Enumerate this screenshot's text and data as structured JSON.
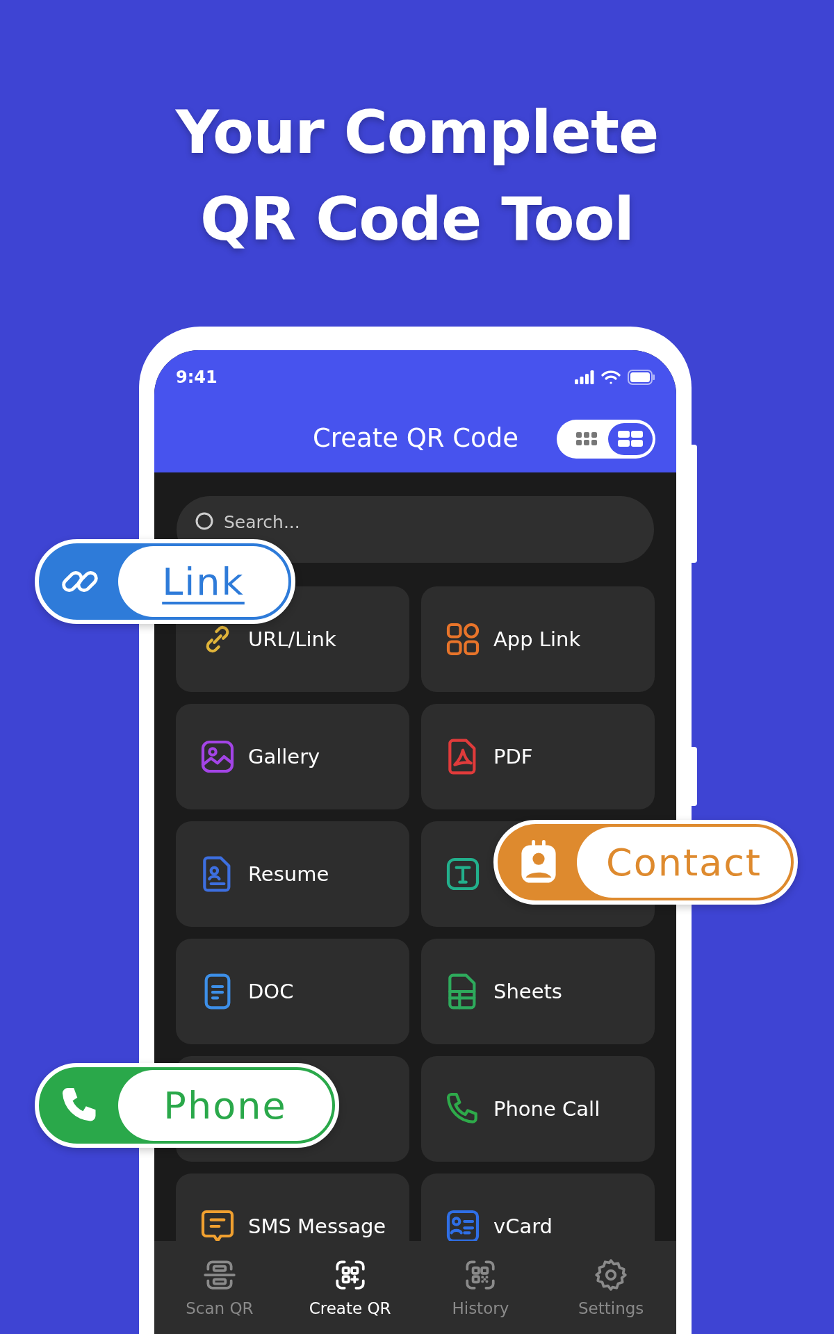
{
  "headline": [
    "Your Complete",
    "QR Code Tool"
  ],
  "status_bar": {
    "time": "9:41"
  },
  "header": {
    "title": "Create QR Code",
    "view_toggle": [
      {
        "kind": "grid",
        "selected": false
      },
      {
        "kind": "list",
        "selected": true
      }
    ]
  },
  "search": {
    "placeholder": "Search..."
  },
  "types": [
    {
      "kind": "url",
      "label": "URL/Link"
    },
    {
      "kind": "app",
      "label": "App Link"
    },
    {
      "kind": "gallery",
      "label": "Gallery"
    },
    {
      "kind": "pdf",
      "label": "PDF"
    },
    {
      "kind": "resume",
      "label": "Resume"
    },
    {
      "kind": "text"
    },
    {
      "kind": "doc",
      "label": "DOC"
    },
    {
      "kind": "sheets",
      "label": "Sheets"
    },
    {
      "kind": "covered"
    },
    {
      "kind": "call",
      "label": "Phone Call"
    },
    {
      "kind": "sms",
      "label": "SMS Message"
    },
    {
      "kind": "vcard",
      "label": "vCard"
    }
  ],
  "bottom_nav": [
    {
      "kind": "scan",
      "label": "Scan QR",
      "selected": false
    },
    {
      "kind": "create",
      "label": "Create QR",
      "selected": true
    },
    {
      "kind": "history",
      "label": "History",
      "selected": false
    },
    {
      "kind": "settings",
      "label": "Settings",
      "selected": false
    }
  ],
  "badges": [
    {
      "kind": "link",
      "label": "Link",
      "color": "#2e7bd9"
    },
    {
      "kind": "contact",
      "label": "Contact",
      "color": "#de8a2e"
    },
    {
      "kind": "phone",
      "label": "Phone",
      "color": "#2aa84a"
    }
  ]
}
